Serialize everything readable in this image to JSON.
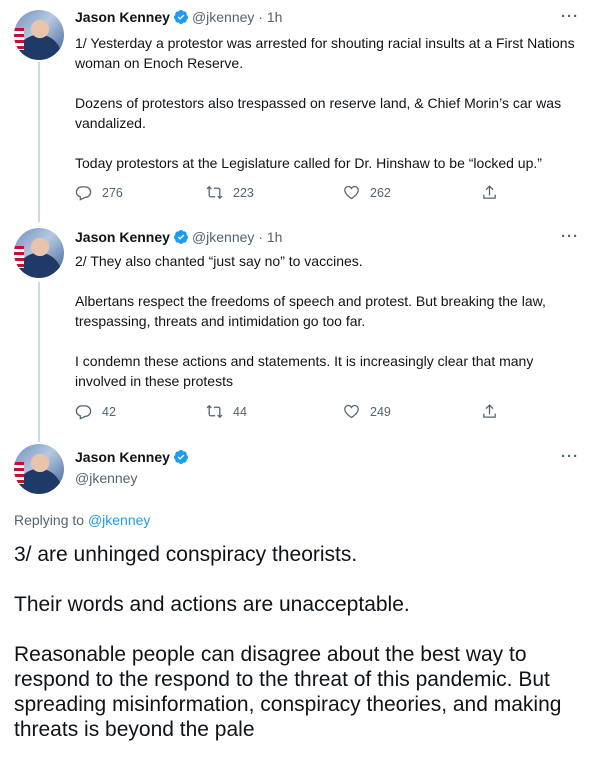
{
  "tweets": [
    {
      "name": "Jason Kenney",
      "handle": "@jkenney",
      "sep": "·",
      "time": "1h",
      "more": "···",
      "paragraphs": [
        "1/ Yesterday a protestor was arrested for shouting racial insults at a First Nations woman on Enoch Reserve.",
        "Dozens of protestors also trespassed on reserve land, & Chief Morin’s car was vandalized.",
        "Today protestors at the Legislature called for Dr. Hinshaw to be “locked up.”"
      ],
      "replies": "276",
      "retweets": "223",
      "likes": "262"
    },
    {
      "name": "Jason Kenney",
      "handle": "@jkenney",
      "sep": "·",
      "time": "1h",
      "more": "···",
      "paragraphs": [
        "2/ They also chanted “just say no” to vaccines.",
        "Albertans respect the freedoms of speech and protest. But breaking the law, trespassing, threats and intimidation go too far.",
        "I condemn these actions and statements. It is increasingly clear that many involved in these protests"
      ],
      "replies": "42",
      "retweets": "44",
      "likes": "249"
    }
  ],
  "main": {
    "name": "Jason Kenney",
    "handle": "@jkenney",
    "more": "···",
    "replying_prefix": "Replying to",
    "replying_to": "@jkenney",
    "paragraphs": [
      "3/ are unhinged conspiracy theorists.",
      "Their words and actions are unacceptable.",
      "Reasonable people can disagree about the best way to respond to the respond to the threat of this pandemic. But spreading misinformation, conspiracy theories, and making threats is beyond the pale"
    ]
  },
  "colors": {
    "text": "#0f1419",
    "secondary": "#536471",
    "accent": "#1d9bf0",
    "thread_line": "#cfd9de"
  },
  "icons": [
    "verified-badge-icon",
    "reply-icon",
    "retweet-icon",
    "like-icon",
    "share-icon",
    "more-icon"
  ]
}
